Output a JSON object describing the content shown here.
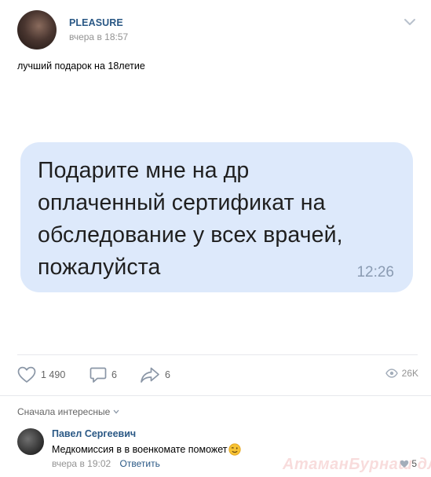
{
  "post": {
    "author": "PLEASURE",
    "date": "вчера в 18:57",
    "text": "лучший подарок на 18летие"
  },
  "message_image": {
    "text": "Подарите мне на др\nоплаченный сертификат на\nобследование у всех врачей,\nпожалуйста",
    "time": "12:26",
    "bubble_color": "#dde9fb"
  },
  "actions": {
    "likes": "1 490",
    "comments": "6",
    "shares": "6",
    "views": "26K"
  },
  "comments": {
    "sort_label": "Сначала интересные",
    "items": [
      {
        "author": "Павел Сергеевич",
        "text": "Медкомиссия в в военкомате поможет",
        "date": "вчера в 19:02",
        "reply_label": "Ответить",
        "likes": "5"
      }
    ]
  },
  "watermark": "АтаманБурнаш для ЯП",
  "colors": {
    "link": "#2a5885",
    "muted": "#939393",
    "separator": "#e7e8ec"
  }
}
